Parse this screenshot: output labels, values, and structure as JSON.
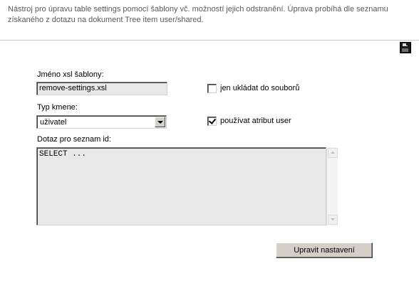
{
  "description": "Nástroj pro úpravu table settings pomocí šablony vč. možností jejich odstranění. Úprava probíhá dle seznamu získaného z dotazu na dokument Tree item user/shared.",
  "toolbar": {
    "save_icon": "floppy-disk-icon"
  },
  "form": {
    "xsl_template": {
      "label": "Jméno xsl šablony:",
      "value": "remove-settings.xsl"
    },
    "root_type": {
      "label": "Typ kmene:",
      "selected": "uživatel"
    },
    "only_save_to_files": {
      "label": "jen ukládat do souborů",
      "checked": false
    },
    "use_user_attribute": {
      "label": "používat atribut user",
      "checked": true
    },
    "id_query": {
      "label": "Dotaz pro seznam id:",
      "value": "SELECT ..."
    },
    "submit_label": "Upravit nastavení"
  }
}
